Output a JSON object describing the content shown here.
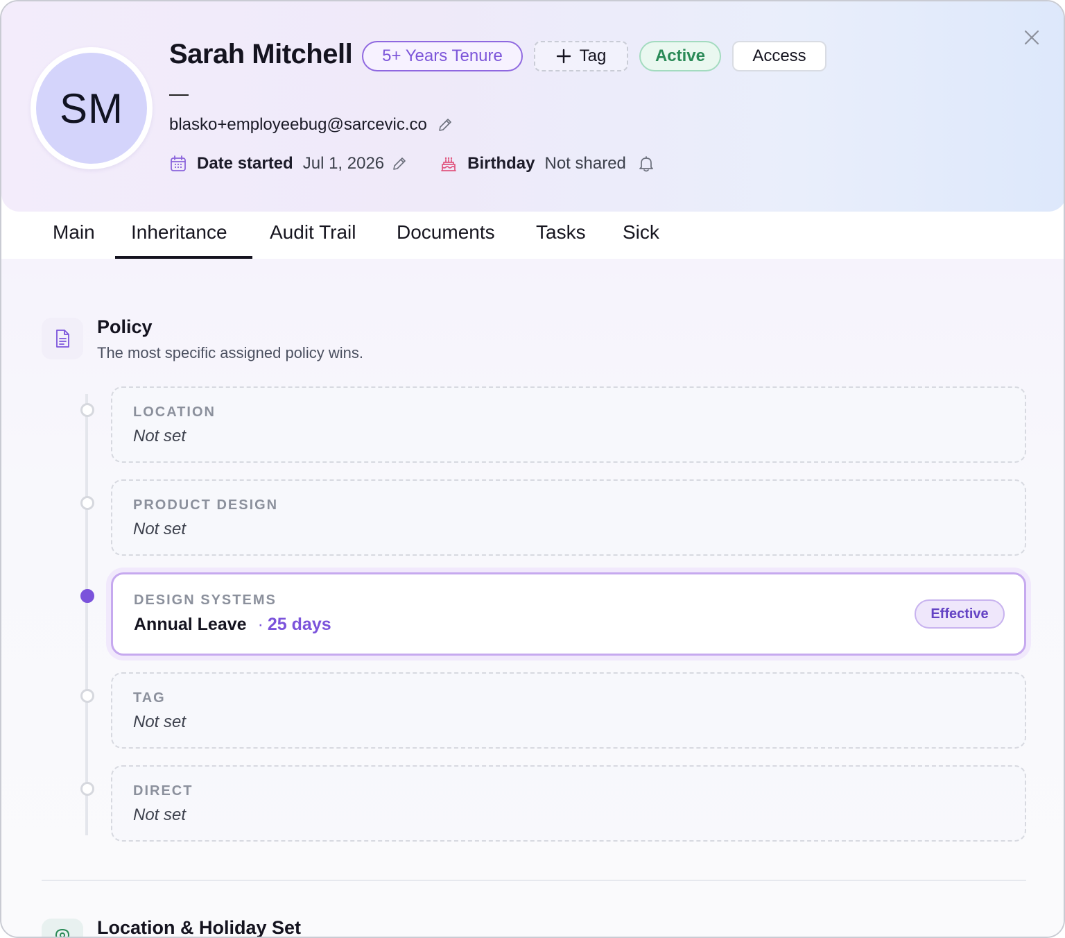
{
  "profile": {
    "initials": "SM",
    "name": "Sarah Mitchell",
    "tenure_badge": "5+ Years Tenure",
    "tag_button": "Tag",
    "status_badge": "Active",
    "access_button": "Access",
    "subtitle": "—",
    "email": "blasko+employeebug@sarcevic.co",
    "date_started_label": "Date started",
    "date_started_value": "Jul 1, 2026",
    "birthday_label": "Birthday",
    "birthday_value": "Not shared"
  },
  "tabs": [
    {
      "label": "Main"
    },
    {
      "label": "Inheritance",
      "active": true
    },
    {
      "label": "Audit Trail"
    },
    {
      "label": "Documents"
    },
    {
      "label": "Tasks"
    },
    {
      "label": "Sick"
    }
  ],
  "policy_section": {
    "title": "Policy",
    "subtitle": "The most specific assigned policy wins.",
    "levels": [
      {
        "label": "LOCATION",
        "value": "Not set"
      },
      {
        "label": "PRODUCT DESIGN",
        "value": "Not set"
      },
      {
        "label": "DESIGN SYSTEMS",
        "policy_name": "Annual Leave",
        "separator": "·",
        "policy_days": "25 days",
        "badge": "Effective"
      },
      {
        "label": "TAG",
        "value": "Not set"
      },
      {
        "label": "DIRECT",
        "value": "Not set"
      }
    ]
  },
  "next_section": {
    "title": "Location & Holiday Set"
  },
  "icons": {
    "close": "close-icon",
    "plus": "plus-icon",
    "edit": "pencil-icon",
    "calendar": "calendar-icon",
    "cake": "cake-icon",
    "bell": "bell-icon",
    "document": "document-icon",
    "location": "location-pin-icon"
  },
  "colors": {
    "accent": "#7b53db",
    "active_green": "#2a8a57",
    "cake_pink": "#e0557f",
    "calendar_purple": "#8a63db"
  }
}
